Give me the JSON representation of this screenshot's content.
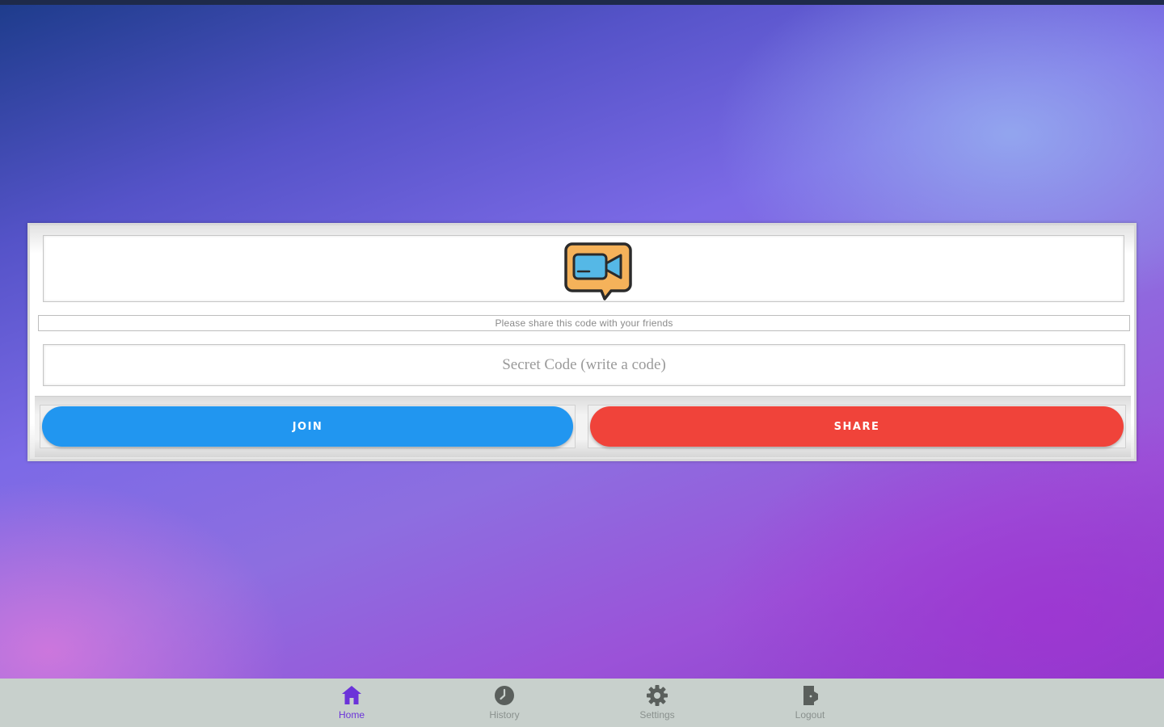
{
  "card": {
    "notice": "Please share this code with your friends",
    "code_placeholder": "Secret Code (write a code)",
    "code_value": "",
    "join_label": "JOIN",
    "share_label": "SHARE"
  },
  "bottom_nav": {
    "items": [
      {
        "label": "Home",
        "icon": "home-icon",
        "active": true
      },
      {
        "label": "History",
        "icon": "history-icon",
        "active": false
      },
      {
        "label": "Settings",
        "icon": "gear-icon",
        "active": false
      },
      {
        "label": "Logout",
        "icon": "logout-icon",
        "active": false
      }
    ]
  },
  "colors": {
    "join_button": "#2196f0",
    "share_button": "#f0433a",
    "nav_active": "#6b33d9",
    "nav_inactive": "#5a5f5c",
    "nav_background": "#c8d0cc"
  }
}
